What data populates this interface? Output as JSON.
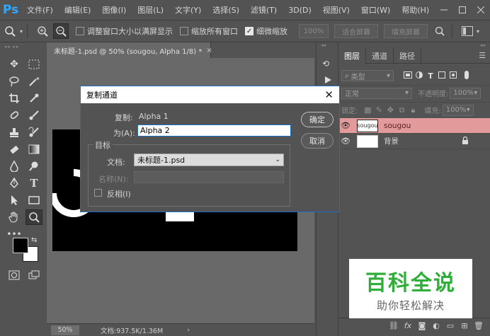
{
  "app": {
    "logo": "Ps",
    "menu": [
      "文件(F)",
      "编辑(E)",
      "图像(I)",
      "图层(L)",
      "文字(Y)",
      "选择(S)",
      "滤镜(T)",
      "3D(D)",
      "视图(V)",
      "窗口(W)",
      "帮助(H)"
    ]
  },
  "options": {
    "resize_windows": "调整窗口大小以满屏显示",
    "zoom_all": "缩放所有窗口",
    "scrubby_zoom": "细微缩放",
    "zoom_value": "100%",
    "fit_screen": "适合屏幕",
    "fill_screen": "填充屏幕",
    "scrubby_zoom_checked": true
  },
  "document": {
    "tab_title": "未标题-1.psd @ 50% (sougou, Alpha 1/8) *",
    "zoom": "50%",
    "doc_size": "文档:937.5K/1.36M"
  },
  "layers_panel": {
    "tabs": [
      "图层",
      "通道",
      "路径"
    ],
    "filter_kind": "类型",
    "blend_mode": "正常",
    "opacity_label": "不透明度:",
    "opacity": "100%",
    "lock_label": "锁定:",
    "fill_label": "填充:",
    "fill": "100%",
    "layers": [
      {
        "name": "sougou",
        "thumb_text": "sougou",
        "selected": true
      },
      {
        "name": "背景",
        "thumb_text": "",
        "selected": false
      }
    ]
  },
  "dialog": {
    "title": "复制通道",
    "source_label": "复制:",
    "source_value": "Alpha 1",
    "as_label": "为(A):",
    "as_value": "Alpha 2",
    "ok": "确定",
    "cancel": "取消",
    "destination_group": "目标",
    "document_label": "文档:",
    "document_value": "未标题-1.psd",
    "name_label": "名称(N):",
    "invert_label": "反相(I)"
  },
  "watermark": {
    "title": "百科全说",
    "subtitle": "助你轻松解决"
  },
  "colors": {
    "accent": "#31a8ff",
    "selected_layer": "#e39a9a",
    "watermark_green": "#2fae3a"
  }
}
